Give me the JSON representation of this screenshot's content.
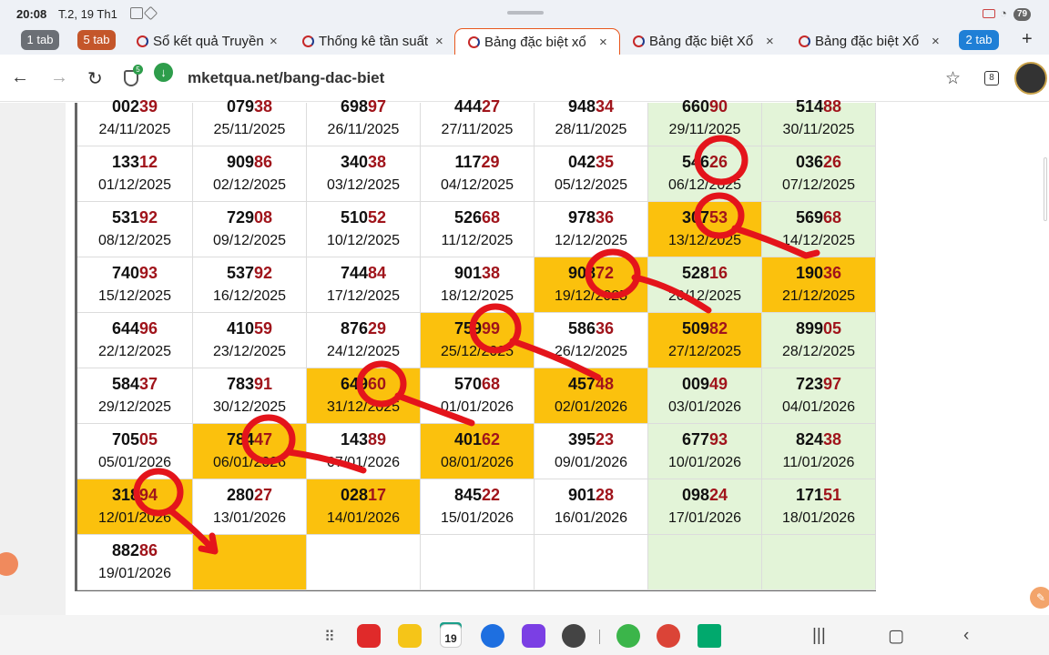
{
  "status": {
    "time": "20:08",
    "date": "T.2, 19 Th1",
    "battery": "79"
  },
  "tabstrip": {
    "group_1": "1 tab",
    "group_2": "5 tab",
    "group_3": "2 tab",
    "tabs": [
      {
        "title": "Sổ kết quả Truyền",
        "active": false
      },
      {
        "title": "Thống kê tần suất",
        "active": false
      },
      {
        "title": "Bảng đặc biệt xổ",
        "active": true
      },
      {
        "title": "Bảng đặc biệt Xổ",
        "active": false
      },
      {
        "title": "Bảng đặc biệt Xổ",
        "active": false
      }
    ],
    "close_glyph": "×",
    "new_tab_glyph": "+",
    "colors": {
      "group_1": "#6b6f75",
      "group_2": "#c4562a",
      "group_3": "#1f7fd6",
      "active_outline": "#e8561c"
    }
  },
  "address": {
    "url": "mketqua.net/bang-dac-biet",
    "shield_badge": "5",
    "tab_count": "8"
  },
  "board": {
    "colors": {
      "highlight": "#fbc10d",
      "weekend": "#e3f4d8",
      "number_tail": "#a0141b"
    },
    "rows": [
      [
        {
          "head": "002",
          "tail": "39",
          "date": "24/11/2025",
          "hl": false
        },
        {
          "head": "079",
          "tail": "38",
          "date": "25/11/2025",
          "hl": false
        },
        {
          "head": "698",
          "tail": "97",
          "date": "26/11/2025",
          "hl": false
        },
        {
          "head": "444",
          "tail": "27",
          "date": "27/11/2025",
          "hl": false
        },
        {
          "head": "948",
          "tail": "34",
          "date": "28/11/2025",
          "hl": false
        },
        {
          "head": "660",
          "tail": "90",
          "date": "29/11/2025",
          "hl": false
        },
        {
          "head": "514",
          "tail": "88",
          "date": "30/11/2025",
          "hl": false
        }
      ],
      [
        {
          "head": "133",
          "tail": "12",
          "date": "01/12/2025",
          "hl": false
        },
        {
          "head": "909",
          "tail": "86",
          "date": "02/12/2025",
          "hl": false
        },
        {
          "head": "340",
          "tail": "38",
          "date": "03/12/2025",
          "hl": false
        },
        {
          "head": "117",
          "tail": "29",
          "date": "04/12/2025",
          "hl": false
        },
        {
          "head": "042",
          "tail": "35",
          "date": "05/12/2025",
          "hl": false
        },
        {
          "head": "546",
          "tail": "26",
          "date": "06/12/2025",
          "hl": false
        },
        {
          "head": "036",
          "tail": "26",
          "date": "07/12/2025",
          "hl": false
        }
      ],
      [
        {
          "head": "531",
          "tail": "92",
          "date": "08/12/2025",
          "hl": false
        },
        {
          "head": "729",
          "tail": "08",
          "date": "09/12/2025",
          "hl": false
        },
        {
          "head": "510",
          "tail": "52",
          "date": "10/12/2025",
          "hl": false
        },
        {
          "head": "526",
          "tail": "68",
          "date": "11/12/2025",
          "hl": false
        },
        {
          "head": "978",
          "tail": "36",
          "date": "12/12/2025",
          "hl": false
        },
        {
          "head": "307",
          "tail": "53",
          "date": "13/12/2025",
          "hl": true
        },
        {
          "head": "569",
          "tail": "68",
          "date": "14/12/2025",
          "hl": false
        }
      ],
      [
        {
          "head": "740",
          "tail": "93",
          "date": "15/12/2025",
          "hl": false
        },
        {
          "head": "537",
          "tail": "92",
          "date": "16/12/2025",
          "hl": false
        },
        {
          "head": "744",
          "tail": "84",
          "date": "17/12/2025",
          "hl": false
        },
        {
          "head": "901",
          "tail": "38",
          "date": "18/12/2025",
          "hl": false
        },
        {
          "head": "908",
          "tail": "72",
          "date": "19/12/2025",
          "hl": true
        },
        {
          "head": "528",
          "tail": "16",
          "date": "20/12/2025",
          "hl": false
        },
        {
          "head": "190",
          "tail": "36",
          "date": "21/12/2025",
          "hl": true
        }
      ],
      [
        {
          "head": "644",
          "tail": "96",
          "date": "22/12/2025",
          "hl": false
        },
        {
          "head": "410",
          "tail": "59",
          "date": "23/12/2025",
          "hl": false
        },
        {
          "head": "876",
          "tail": "29",
          "date": "24/12/2025",
          "hl": false
        },
        {
          "head": "759",
          "tail": "99",
          "date": "25/12/2025",
          "hl": true
        },
        {
          "head": "586",
          "tail": "36",
          "date": "26/12/2025",
          "hl": false
        },
        {
          "head": "509",
          "tail": "82",
          "date": "27/12/2025",
          "hl": true
        },
        {
          "head": "899",
          "tail": "05",
          "date": "28/12/2025",
          "hl": false
        }
      ],
      [
        {
          "head": "584",
          "tail": "37",
          "date": "29/12/2025",
          "hl": false
        },
        {
          "head": "783",
          "tail": "91",
          "date": "30/12/2025",
          "hl": false
        },
        {
          "head": "649",
          "tail": "60",
          "date": "31/12/2025",
          "hl": true
        },
        {
          "head": "570",
          "tail": "68",
          "date": "01/01/2026",
          "hl": false
        },
        {
          "head": "457",
          "tail": "48",
          "date": "02/01/2026",
          "hl": true
        },
        {
          "head": "009",
          "tail": "49",
          "date": "03/01/2026",
          "hl": false
        },
        {
          "head": "723",
          "tail": "97",
          "date": "04/01/2026",
          "hl": false
        }
      ],
      [
        {
          "head": "705",
          "tail": "05",
          "date": "05/01/2026",
          "hl": false
        },
        {
          "head": "784",
          "tail": "47",
          "date": "06/01/2026",
          "hl": true
        },
        {
          "head": "143",
          "tail": "89",
          "date": "07/01/2026",
          "hl": false
        },
        {
          "head": "401",
          "tail": "62",
          "date": "08/01/2026",
          "hl": true
        },
        {
          "head": "395",
          "tail": "23",
          "date": "09/01/2026",
          "hl": false
        },
        {
          "head": "677",
          "tail": "93",
          "date": "10/01/2026",
          "hl": false
        },
        {
          "head": "824",
          "tail": "38",
          "date": "11/01/2026",
          "hl": false
        }
      ],
      [
        {
          "head": "318",
          "tail": "94",
          "date": "12/01/2026",
          "hl": true
        },
        {
          "head": "280",
          "tail": "27",
          "date": "13/01/2026",
          "hl": false
        },
        {
          "head": "028",
          "tail": "17",
          "date": "14/01/2026",
          "hl": true
        },
        {
          "head": "845",
          "tail": "22",
          "date": "15/01/2026",
          "hl": false
        },
        {
          "head": "901",
          "tail": "28",
          "date": "16/01/2026",
          "hl": false
        },
        {
          "head": "098",
          "tail": "24",
          "date": "17/01/2026",
          "hl": false
        },
        {
          "head": "171",
          "tail": "51",
          "date": "18/01/2026",
          "hl": false
        }
      ],
      [
        {
          "head": "882",
          "tail": "86",
          "date": "19/01/2026",
          "hl": false
        },
        {
          "head": "",
          "tail": "",
          "date": "",
          "hl": true
        },
        {
          "head": "",
          "tail": "",
          "date": "",
          "hl": false
        },
        {
          "head": "",
          "tail": "",
          "date": "",
          "hl": false
        },
        {
          "head": "",
          "tail": "",
          "date": "",
          "hl": false
        },
        {
          "head": "",
          "tail": "",
          "date": "",
          "hl": false
        },
        {
          "head": "",
          "tail": "",
          "date": "",
          "hl": false
        }
      ]
    ]
  },
  "navbar": {
    "calendar_day": "19",
    "apps": [
      {
        "icon": "notes-app-icon",
        "color": "#e02a2a"
      },
      {
        "icon": "folder-app-icon",
        "color": "#f5c518"
      },
      {
        "icon": "messages-app-icon",
        "color": "#1e6fe0"
      },
      {
        "icon": "browser-app-icon",
        "color": "#7b3fe4"
      },
      {
        "icon": "camera-app-icon",
        "color": "#444444"
      },
      {
        "icon": "lottery-app-icon",
        "color": "#3bb54a"
      },
      {
        "icon": "chrome-app-icon",
        "color": "#db4437"
      },
      {
        "icon": "play-store-icon",
        "color": "#01a96d"
      }
    ]
  }
}
